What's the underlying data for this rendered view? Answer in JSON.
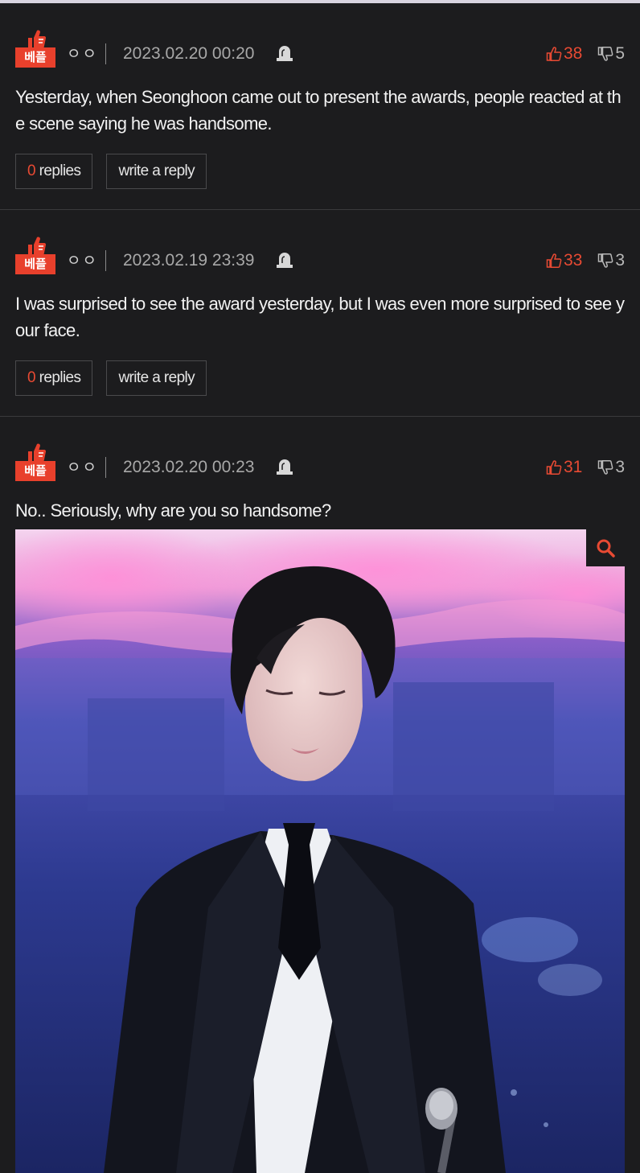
{
  "comments": [
    {
      "badge": "베플",
      "nickname": "ㅇㅇ",
      "timestamp": "2023.02.20 00:20",
      "upvotes": "38",
      "downvotes": "5",
      "text": "Yesterday, when Seonghoon came out to present the awards, people reacted at the scene saying he was handsome.",
      "replies_count": "0",
      "replies_label": "replies",
      "write_reply_label": "write a reply"
    },
    {
      "badge": "베플",
      "nickname": "ㅇㅇ",
      "timestamp": "2023.02.19 23:39",
      "upvotes": "33",
      "downvotes": "3",
      "text": "I was surprised to see the award yesterday, but I was even more surprised to see your face.",
      "replies_count": "0",
      "replies_label": "replies",
      "write_reply_label": "write a reply"
    },
    {
      "badge": "베플",
      "nickname": "ㅇㅇ",
      "timestamp": "2023.02.20 00:23",
      "upvotes": "31",
      "downvotes": "3",
      "text": "No.. Seriously, why are you so handsome?"
    }
  ],
  "icons": {
    "badge": "thumbs-up-best-icon",
    "report": "siren-icon",
    "upvote": "thumbs-up-icon",
    "downvote": "thumbs-down-icon",
    "zoom": "magnifier-icon"
  },
  "colors": {
    "background": "#1c1c1e",
    "accent": "#e84a33",
    "badge": "#e8402c",
    "text": "#f2f2f2",
    "muted": "#a8a8a8"
  }
}
